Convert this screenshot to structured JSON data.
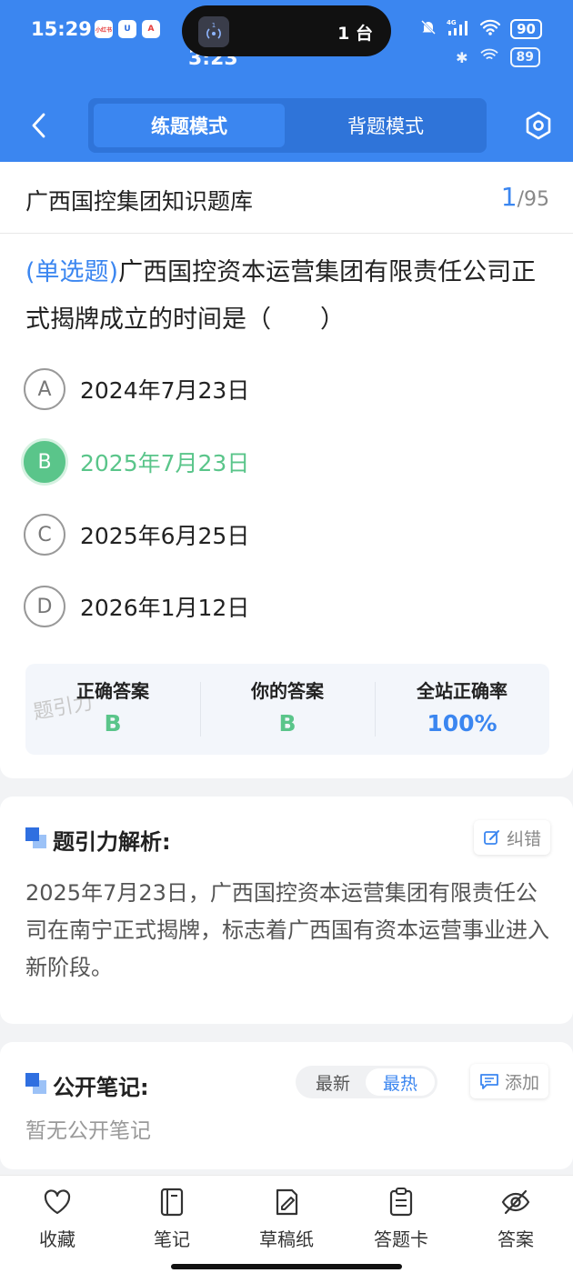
{
  "status_bar": {
    "time": "15:29",
    "apps": [
      "小红书",
      "U",
      "A"
    ],
    "island_badge": "1",
    "island_text": "1 台",
    "background_time": "3:23",
    "network": "4G",
    "battery": "90",
    "background_battery": "89"
  },
  "header": {
    "tabs": [
      {
        "label": "练题模式",
        "active": true
      },
      {
        "label": "背题模式",
        "active": false
      }
    ],
    "accent_color": "#3b86f0"
  },
  "question_card": {
    "bank_title": "广西国控集团知识题库",
    "progress_current": "1",
    "progress_total": "/95",
    "question_type": "(单选题)",
    "question_text": "广西国控资本运营集团有限责任公司正式揭牌成立的时间是（　　）",
    "options": [
      {
        "letter": "A",
        "text": "2024年7月23日",
        "state": "normal"
      },
      {
        "letter": "B",
        "text": "2025年7月23日",
        "state": "correct"
      },
      {
        "letter": "C",
        "text": "2025年6月25日",
        "state": "normal"
      },
      {
        "letter": "D",
        "text": "2026年1月12日",
        "state": "normal"
      }
    ],
    "answer_summary": {
      "correct_label": "正确答案",
      "correct_value": "B",
      "yours_label": "你的答案",
      "yours_value": "B",
      "rate_label": "全站正确率",
      "rate_value": "100%"
    },
    "watermark": "题引力"
  },
  "analysis": {
    "title": "题引力解析:",
    "report_label": "纠错",
    "text": "2025年7月23日，广西国控资本运营集团有限责任公司在南宁正式揭牌，标志着广西国有资本运营事业进入新阶段。"
  },
  "notes": {
    "title": "公开笔记:",
    "sort_newest": "最新",
    "sort_hottest": "最热",
    "add_label": "添加",
    "empty_text": "暂无公开笔记"
  },
  "bottom_bar": {
    "tabs": [
      {
        "label": "收藏",
        "icon": "heart-icon"
      },
      {
        "label": "笔记",
        "icon": "notebook-icon"
      },
      {
        "label": "草稿纸",
        "icon": "draft-paper-icon"
      },
      {
        "label": "答题卡",
        "icon": "answer-sheet-icon"
      },
      {
        "label": "答案",
        "icon": "eye-off-icon"
      }
    ]
  },
  "colors": {
    "correct_green": "#5ac58a",
    "primary_blue": "#3b86f0"
  }
}
